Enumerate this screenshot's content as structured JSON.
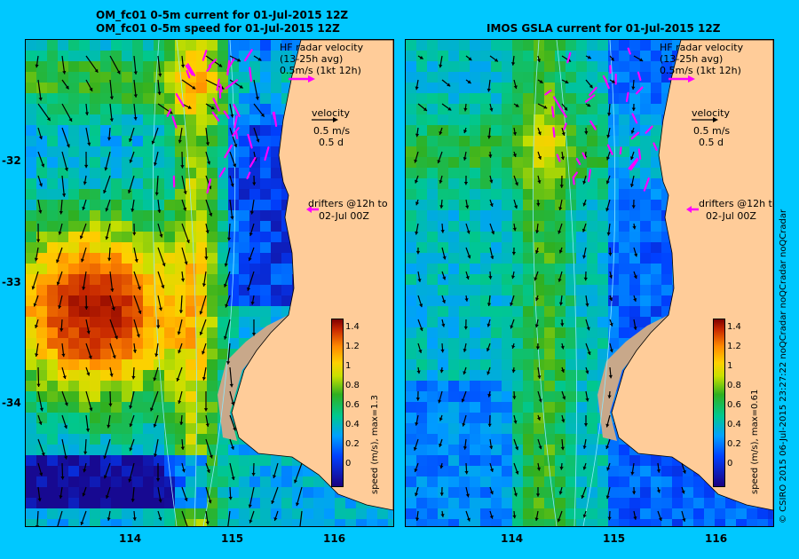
{
  "left_panel": {
    "title_line1": "OM_fc01 0-5m current for 01-Jul-2015 12Z",
    "title_line2": "OM_fc01 0-5m speed for 01-Jul-2015 12Z",
    "colorbar_label": "speed (m/s), max=1.3",
    "max_speed": 1.3
  },
  "right_panel": {
    "title": "IMOS GSLA current for 01-Jul-2015 12Z",
    "colorbar_label": "speed (m/s), max=0.61",
    "max_speed": 0.61
  },
  "legend": {
    "hf_line1": "HF radar velocity",
    "hf_line2": "(13-25h avg)",
    "hf_line3": "0.5m/s (1kt 12h)",
    "velocity_title": "velocity",
    "velocity_speed": "0.5 m/s",
    "velocity_days": "0.5 d",
    "drifters_line1": "drifters @12h to",
    "drifters_line2": "02-Jul 00Z"
  },
  "axes": {
    "x_ticks": [
      "114",
      "115",
      "116"
    ],
    "y_ticks": [
      "-32",
      "-33",
      "-34"
    ]
  },
  "colorbar_ticks": [
    "1.4",
    "1.2",
    "1",
    "0.8",
    "0.6",
    "0.4",
    "0.2",
    "0"
  ],
  "copyright": "© CSIRO 2015   06-Jul-2015 23:27:22 noQCradar noQCradar noQCradar",
  "colors": {
    "background": "#00c8ff",
    "land": "#ffcc99",
    "shelf": "#c8a88a",
    "hf_radar_arrows": "#ff00ff",
    "ocean_fast": "#c81e00",
    "ocean_slow": "#1030c0"
  }
}
